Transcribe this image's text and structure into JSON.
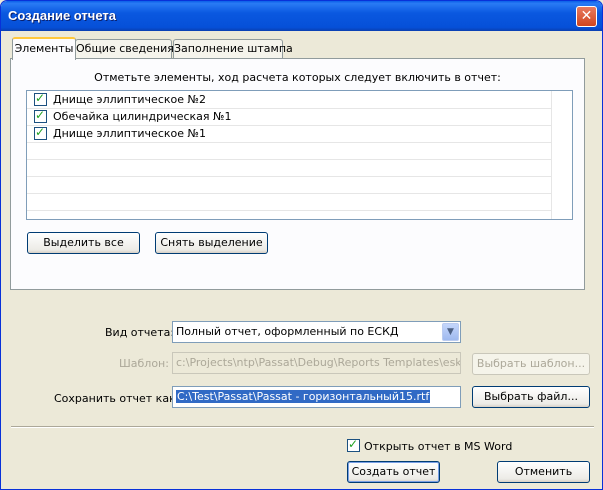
{
  "window": {
    "title": "Создание отчета"
  },
  "tabs": [
    {
      "label": "Элементы"
    },
    {
      "label": "Общие сведения"
    },
    {
      "label": "Заполнение штампа"
    }
  ],
  "elements_tab": {
    "instruction": "Отметьте элементы, ход расчета которых следует включить в отчет:",
    "items": [
      {
        "label": "Днище эллиптическое №2",
        "checked": true
      },
      {
        "label": "Обечайка цилиндрическая №1",
        "checked": true
      },
      {
        "label": "Днище эллиптическое №1",
        "checked": true
      }
    ],
    "select_all_label": "Выделить все",
    "deselect_label": "Снять выделение"
  },
  "form": {
    "report_type_label": "Вид отчета:",
    "report_type_value": "Полный отчет, оформленный по ЕСКД",
    "template_label": "Шаблон:",
    "template_value": "c:\\Projects\\ntp\\Passat\\Debug\\Reports Templates\\eskd.rt",
    "choose_template_label": "Выбрать шаблон...",
    "save_as_label": "Сохранить отчет как:",
    "save_as_value": "C:\\Test\\Passat\\Passat - горизонтальный15.rtf",
    "choose_file_label": "Выбрать файл..."
  },
  "footer": {
    "open_in_word_label": "Открыть отчет в MS Word",
    "open_in_word_checked": true,
    "create_label": "Создать отчет",
    "cancel_label": "Отменить"
  },
  "icons": {
    "close": "close-icon",
    "check": "checkmark-icon",
    "dropdown": "chevron-down-icon"
  },
  "colors": {
    "titlebar": "#0a58e0",
    "tab_accent": "#ffc83c",
    "selection": "#316ac5"
  }
}
